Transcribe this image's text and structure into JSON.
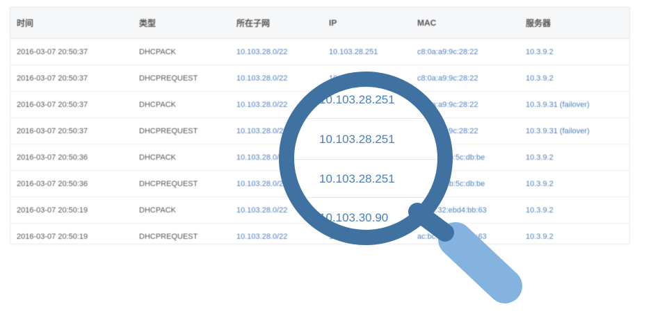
{
  "table": {
    "headers": [
      "时间",
      "类型",
      "所在子网",
      "IP",
      "MAC",
      "服务器"
    ],
    "rows": [
      [
        "2016-03-07 20:50:37",
        "DHCPACK",
        "10.103.28.0/22",
        "10.103.28.251",
        "c8:0a:a9:9c:28:22",
        "10.3.9.2"
      ],
      [
        "2016-03-07 20:50:37",
        "DHCPREQUEST",
        "10.103.28.0/22",
        "10.103.28.251",
        "c8:0a:a9:9c:28:22",
        "10.3.9.2"
      ],
      [
        "2016-03-07 20:50:37",
        "DHCPACK",
        "10.103.28.0/22",
        "10.103.28.251",
        "c8:0a:a9:9c:28:22",
        "10.3.9.31 (failover)"
      ],
      [
        "2016-03-07 20:50:37",
        "DHCPREQUEST",
        "10.103.28.0/22",
        "10.103.28.251",
        "c8:0a:a9:9c:28:22",
        "10.3.9.31 (failover)"
      ],
      [
        "2016-03-07 20:50:36",
        "DHCPACK",
        "10.103.28.0/22",
        "10.103.28.251",
        "f4:0f:24:3b:5c:db:be",
        "10.3.9.2"
      ],
      [
        "2016-03-07 20:50:36",
        "DHCPREQUEST",
        "10.103.28.0/22",
        "10.103.28.251",
        "f4:0f:24:3b:5c:db:be",
        "10.3.9.2"
      ],
      [
        "2016-03-07 20:50:19",
        "DHCPACK",
        "10.103.28.0/22",
        "10.103.30.90",
        "ac:bc:32:ebd4:bb:63",
        "10.3.9.2"
      ],
      [
        "2016-03-07 20:50:19",
        "DHCPREQUEST",
        "10.103.28.0/22",
        "10.103.30.90",
        "ac:bc:32:ebd4:bb:63",
        "10.3.9.2"
      ]
    ]
  },
  "magnifier": {
    "values": [
      "10.103.28.251",
      "10.103.28.251",
      "10.103.28.251",
      "10.103.30.90"
    ],
    "ring_color": "#3f72a0",
    "handle_color": "#85b3df"
  }
}
